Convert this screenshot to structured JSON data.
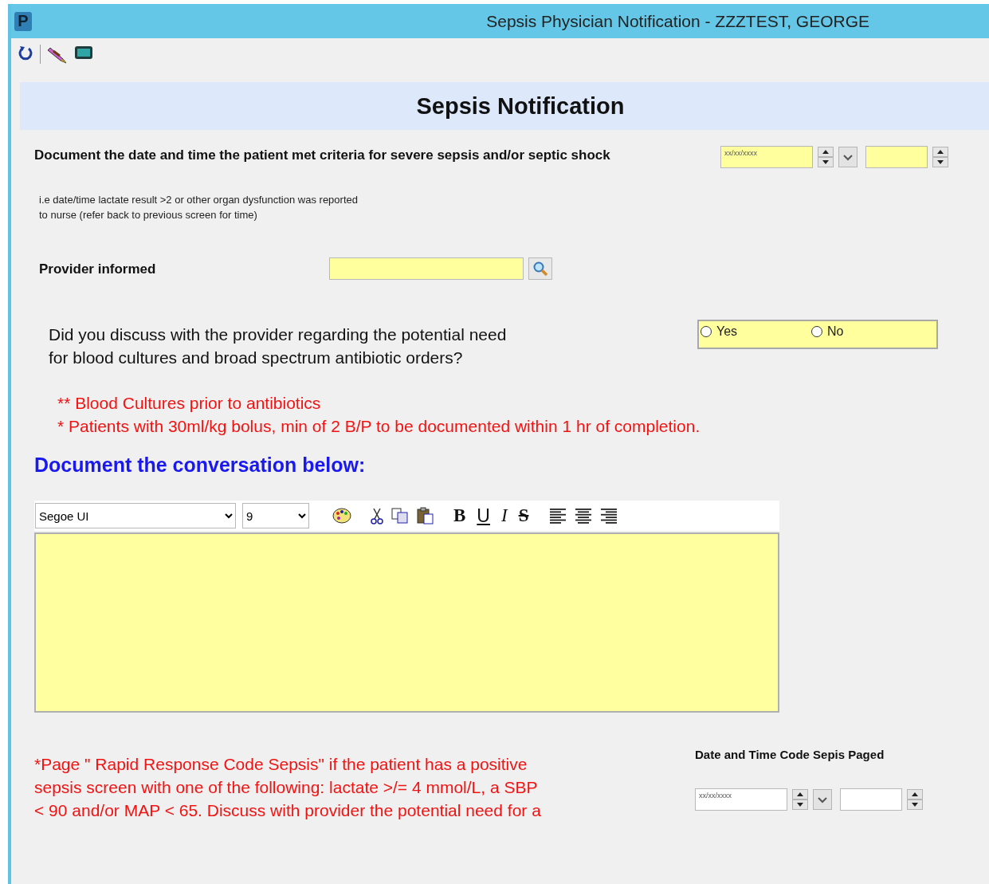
{
  "window": {
    "app_icon": "P",
    "title": "Sepsis Physician Notification - ZZZTEST, GEORGE"
  },
  "header": "Sepsis Notification",
  "criteria": {
    "label": "Document the date and time the patient met criteria for severe sepsis and/or septic shock",
    "hint_lines": [
      "i.e date/time lactate result >2 or other organ dysfunction was reported",
      "to nurse (refer back to previous screen for time)"
    ],
    "date": {
      "placeholder": "xx/xx/xxxx",
      "required": true
    },
    "time": {
      "required": true
    }
  },
  "provider": {
    "label": "Provider informed",
    "required": true
  },
  "discussion": {
    "question_lines": [
      "Did you discuss with the provider regarding the potential need",
      "for blood cultures and broad spectrum antibiotic orders?"
    ],
    "required": true,
    "options": [
      {
        "label": "Yes",
        "selected": false
      },
      {
        "label": "No",
        "selected": false
      }
    ]
  },
  "notes": [
    "** Blood Cultures prior to antibiotics",
    "* Patients with 30ml/kg bolus, min of 2 B/P to be documented within 1 hr of completion."
  ],
  "conversation": {
    "heading": "Document the conversation below:",
    "font": "Segoe UI",
    "size": "9",
    "format_buttons": [
      "B",
      "U",
      "I",
      "S"
    ],
    "required": true
  },
  "footer": {
    "note_lines": [
      "*Page \" Rapid Response Code Sepsis\" if the patient has a positive",
      "sepsis screen with one of the following:  lactate >/= 4 mmol/L,  a SBP",
      "< 90 and/or MAP < 65. Discuss with provider the potential need for a"
    ],
    "paged_label": "Date and Time Code Sepis Paged",
    "date": {
      "placeholder": "xx/xx/xxxx",
      "required": false
    },
    "time": {
      "required": false
    }
  }
}
